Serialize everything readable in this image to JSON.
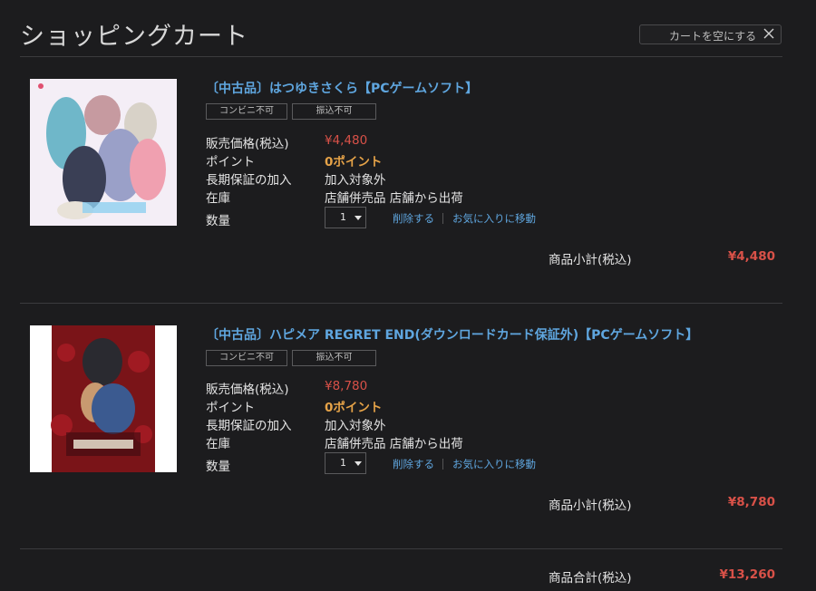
{
  "page": {
    "title": "ショッピングカート",
    "clear_cart_label": "カートを空にする"
  },
  "labels": {
    "price": "販売価格(税込)",
    "point": "ポイント",
    "warranty": "長期保証の加入",
    "stock": "在庫",
    "quantity": "数量",
    "delete": "削除する",
    "move_to_favorites": "お気に入りに移動",
    "subtotal": "商品小計(税込)"
  },
  "items": [
    {
      "name": "〔中古品〕はつゆきさくら【PCゲームソフト】",
      "tags": [
        "コンビニ不可",
        "振込不可"
      ],
      "price": "¥4,480",
      "point": "0ポイント",
      "warranty": "加入対象外",
      "stock": "店舗併売品 店舗から出荷",
      "quantity": "1",
      "subtotal": "¥4,480"
    },
    {
      "name": "〔中古品〕ハピメア REGRET END(ダウンロードカード保証外)【PCゲームソフト】",
      "tags": [
        "コンビニ不可",
        "振込不可"
      ],
      "price": "¥8,780",
      "point": "0ポイント",
      "warranty": "加入対象外",
      "stock": "店舗併売品 店舗から出荷",
      "quantity": "1",
      "subtotal": "¥8,780"
    }
  ],
  "total": {
    "label": "商品合計(税込)",
    "value": "¥13,260"
  },
  "colors": {
    "background": "#1c1c1e",
    "link": "#5fa6df",
    "price": "#d85148",
    "point": "#e6a348"
  }
}
